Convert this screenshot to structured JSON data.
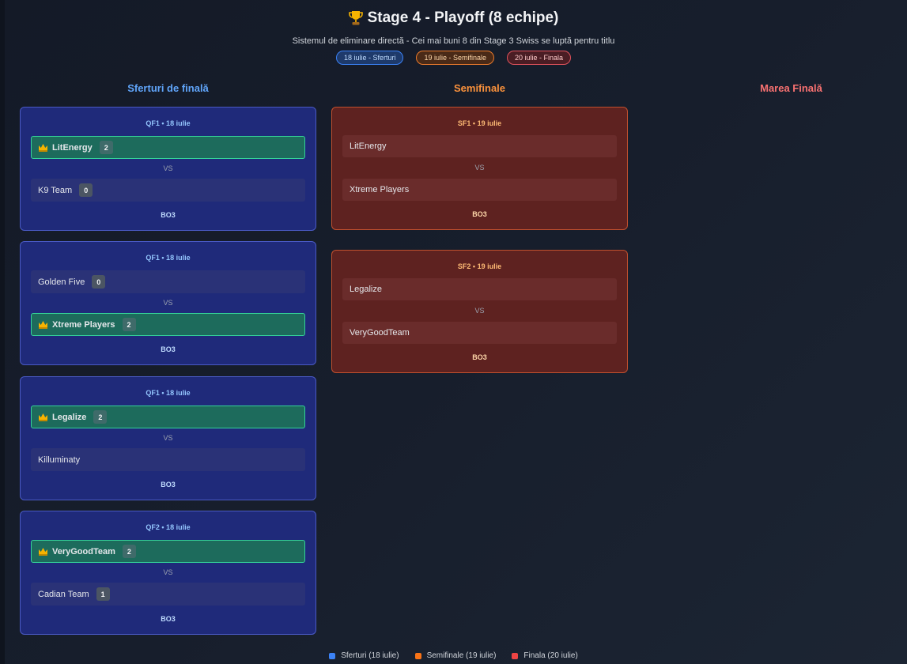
{
  "header": {
    "title": "Stage 4 - Playoff (8 echipe)",
    "subtitle": "Sistemul de eliminare directă - Cei mai buni 8 din Stage 3 Swiss se luptă pentru titlu",
    "badges": [
      "18 iulie - Sferturi",
      "19 iulie - Semifinale",
      "20 iulie - Finala"
    ]
  },
  "columns": {
    "quarterfinals": "Sferturi de finală",
    "semifinals": "Semifinale",
    "final": "Marea Finală"
  },
  "quarterfinals": [
    {
      "label": "QF1 • 18 iulie",
      "team1": "LitEnergy",
      "score1": "2",
      "team2": "K9 Team",
      "score2": "0",
      "winner": 1,
      "vs": "VS",
      "format": "BO3"
    },
    {
      "label": "QF1 • 18 iulie",
      "team1": "Golden Five",
      "score1": "0",
      "team2": "Xtreme Players",
      "score2": "2",
      "winner": 2,
      "vs": "VS",
      "format": "BO3"
    },
    {
      "label": "QF1 • 18 iulie",
      "team1": "Legalize",
      "score1": "2",
      "team2": "Killuminaty",
      "score2": "",
      "winner": 1,
      "vs": "VS",
      "format": "BO3"
    },
    {
      "label": "QF2 • 18 iulie",
      "team1": "VeryGoodTeam",
      "score1": "2",
      "team2": "Cadian Team",
      "score2": "1",
      "winner": 1,
      "vs": "VS",
      "format": "BO3"
    }
  ],
  "semifinals": [
    {
      "label": "SF1 • 19 iulie",
      "team1": "LitEnergy",
      "team2": "Xtreme Players",
      "vs": "VS",
      "format": "BO3"
    },
    {
      "label": "SF2 • 19 iulie",
      "team1": "Legalize",
      "team2": "VeryGoodTeam",
      "vs": "VS",
      "format": "BO3"
    }
  ],
  "legend": [
    {
      "label": "Sferturi (18 iulie)",
      "color": "#3b82f6"
    },
    {
      "label": "Semifinale (19 iulie)",
      "color": "#f97316"
    },
    {
      "label": "Finala (20 iulie)",
      "color": "#ef4444"
    }
  ],
  "icons": {
    "title": "trophy-icon",
    "winner": "crown-icon"
  }
}
